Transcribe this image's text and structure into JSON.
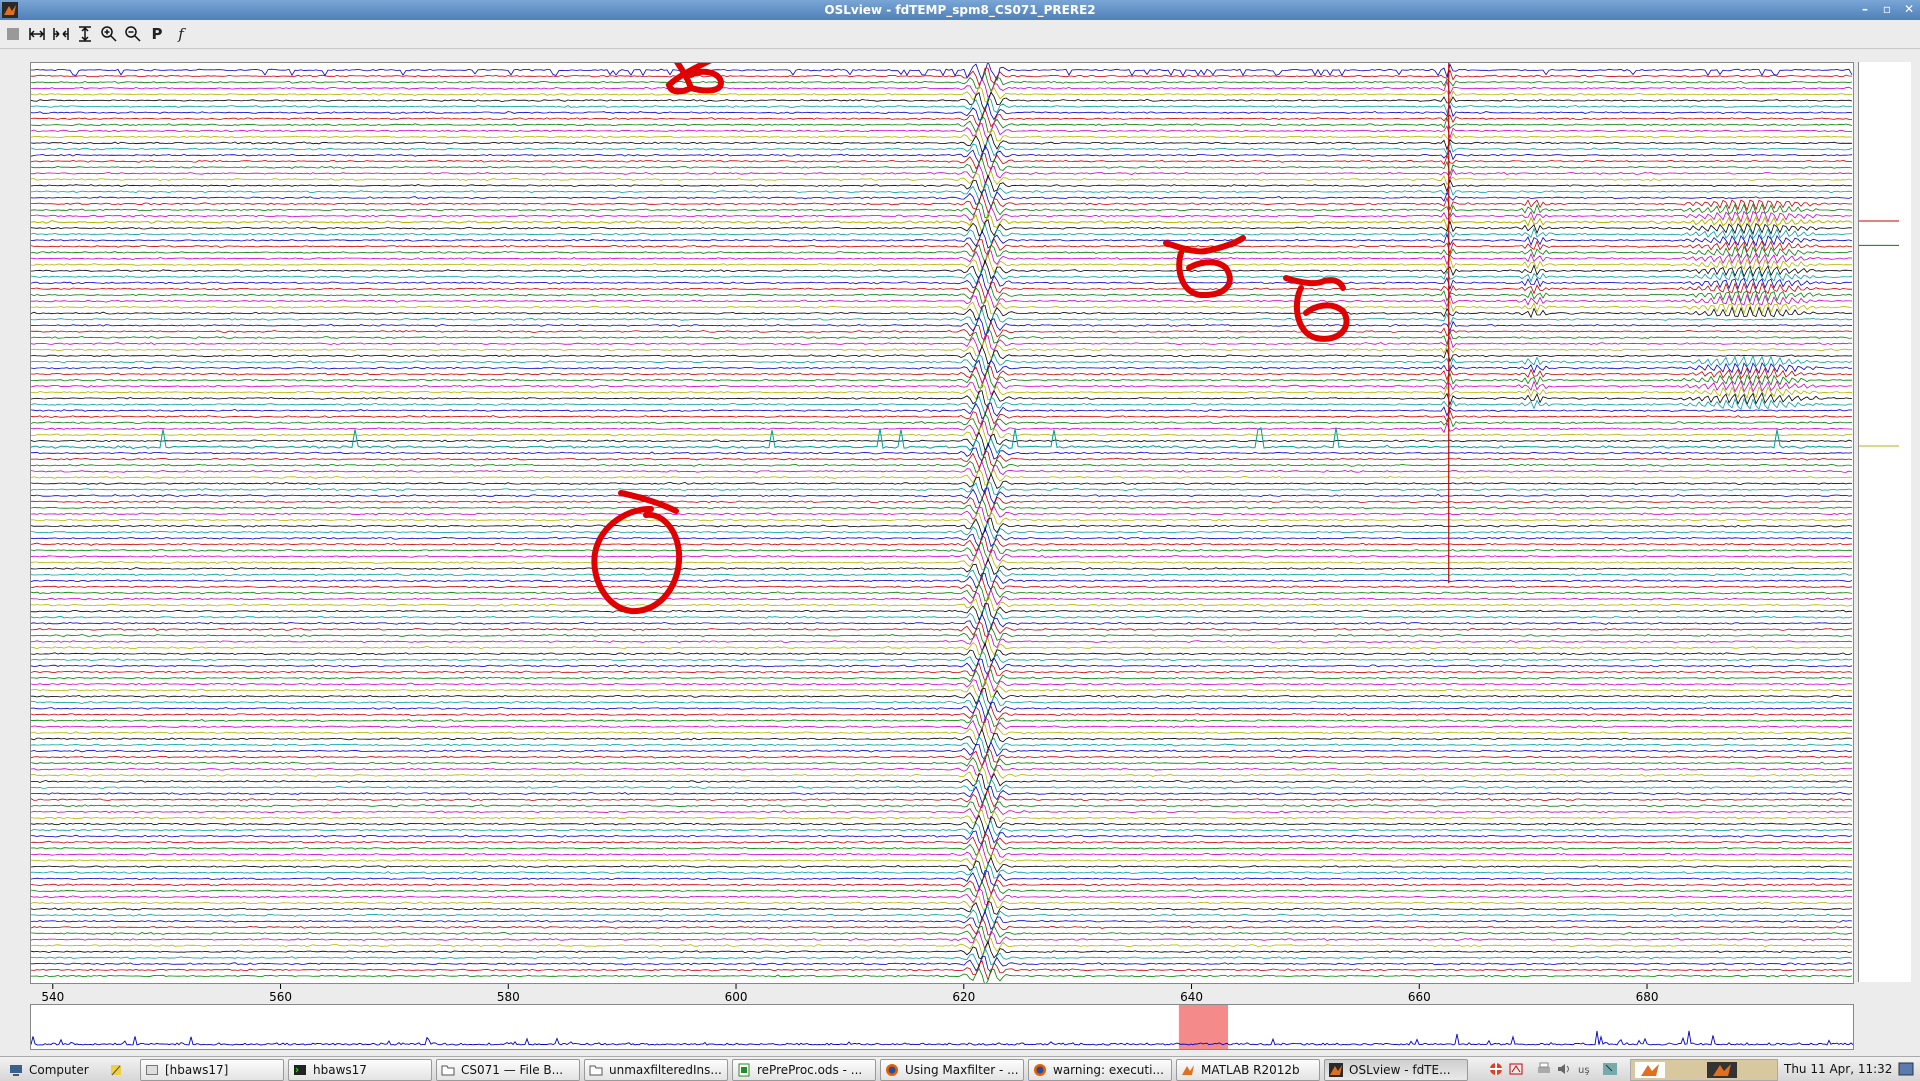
{
  "window": {
    "title": "OSLview - fdTEMP_spm8_CS071_PRERE2",
    "controls": [
      "–",
      "▫",
      "✕"
    ]
  },
  "toolbar": {
    "buttons": [
      {
        "name": "stop-button",
        "icon": "stop-icon"
      },
      {
        "name": "expand-time-button",
        "icon": "expand-horizontal-icon"
      },
      {
        "name": "contract-time-button",
        "icon": "contract-horizontal-icon"
      },
      {
        "name": "scale-vertical-button",
        "icon": "expand-vertical-icon"
      },
      {
        "name": "zoom-in-button",
        "icon": "zoom-in-icon"
      },
      {
        "name": "zoom-out-button",
        "icon": "zoom-out-icon"
      },
      {
        "name": "p-button",
        "label": "P"
      },
      {
        "name": "function-button",
        "label": "f"
      }
    ]
  },
  "chart_data": {
    "type": "line",
    "description_kind": "multichannel MEG time series (butterfly stacked traces)",
    "x_ticks": [
      540,
      560,
      580,
      600,
      620,
      640,
      660,
      680
    ],
    "x_range": [
      538,
      698
    ],
    "n_channels": 150,
    "series_colors": [
      "#0000c8",
      "#c80000",
      "#008000",
      "#c800c8",
      "#b4b400",
      "#000000",
      "#00a0a0"
    ],
    "events": [
      {
        "type": "burst",
        "x": 621.8
      },
      {
        "type": "spike",
        "x": 662.5
      },
      {
        "type": "burst",
        "x": 670
      },
      {
        "type": "burst",
        "x": 689
      }
    ],
    "overview": {
      "x_range": [
        0,
        1000
      ],
      "highlight_range": [
        630,
        657
      ],
      "highlight_color": "#f58a8a"
    }
  },
  "annotations": {
    "color": "#e00000",
    "marks": [
      "scribble-1",
      "scribble-2",
      "scribble-3",
      "circle-1"
    ]
  },
  "taskbar": {
    "items": [
      {
        "label": "Computer",
        "icon": "computer-icon"
      },
      {
        "label": "",
        "icon": "notes-icon"
      },
      {
        "label": "[hbaws17]",
        "icon": "terminal-icon"
      },
      {
        "label": "hbaws17",
        "icon": "terminal-icon"
      },
      {
        "label": "CS071 — File B...",
        "icon": "folder-icon"
      },
      {
        "label": "unmaxfilteredIns...",
        "icon": "folder-icon"
      },
      {
        "label": "rePreProc.ods - ...",
        "icon": "spreadsheet-icon"
      },
      {
        "label": "Using Maxfilter - ...",
        "icon": "firefox-icon"
      },
      {
        "label": "warning: executi...",
        "icon": "firefox-icon"
      },
      {
        "label": "MATLAB R2012b",
        "icon": "matlab-icon"
      },
      {
        "label": "OSLview - fdTE...",
        "icon": "matlab-icon"
      }
    ],
    "clock": "Thu 11 Apr, 11:32"
  }
}
